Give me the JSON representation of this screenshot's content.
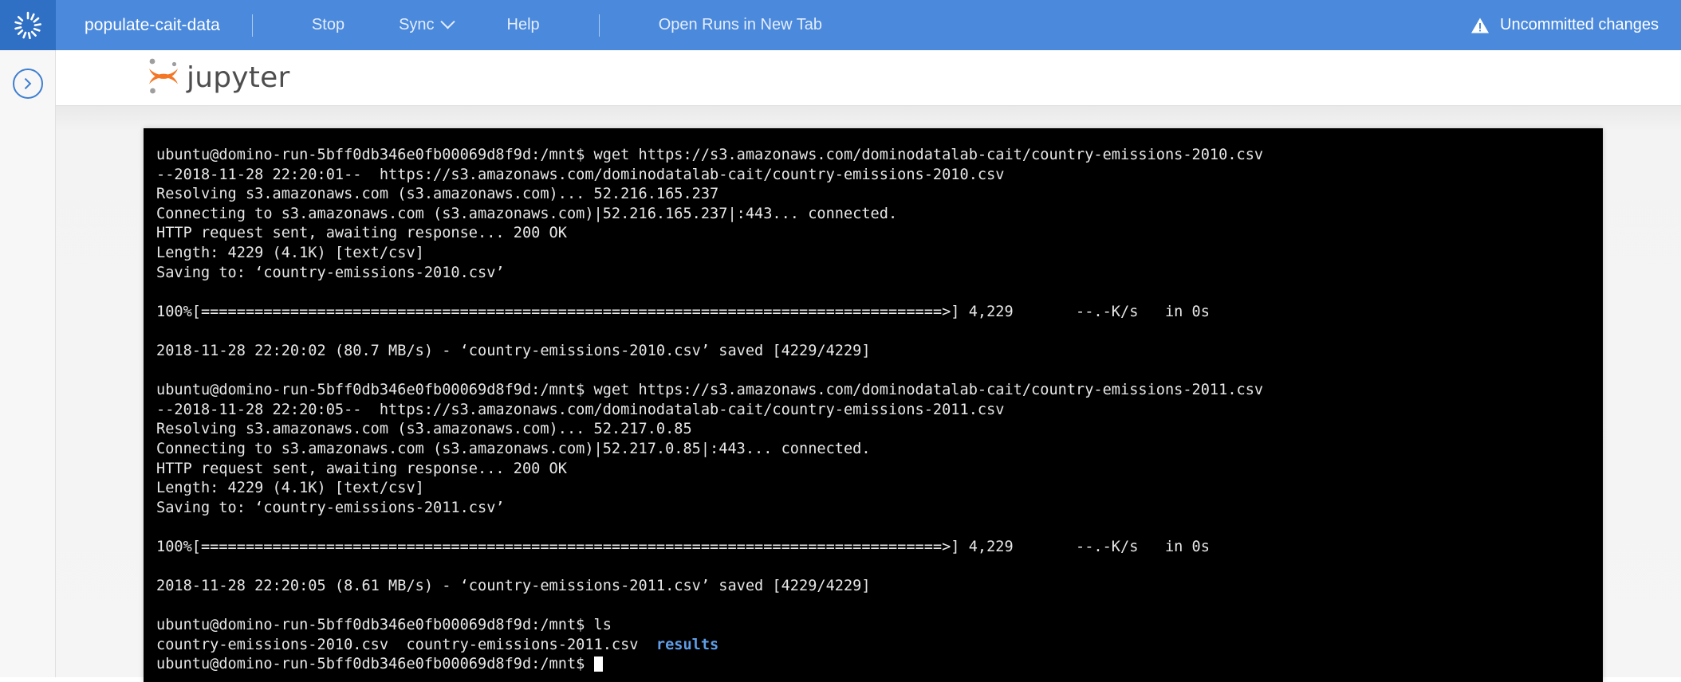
{
  "topbar": {
    "logo_icon": "domino-sunburst-icon",
    "project_title": "populate-cait-data",
    "items": [
      {
        "label": "Stop",
        "icon": null
      },
      {
        "label": "Sync",
        "icon": "chevron-down-icon"
      },
      {
        "label": "Help",
        "icon": null
      },
      {
        "label": "Open Runs in New Tab",
        "icon": null
      }
    ],
    "status": {
      "icon": "warning-triangle-icon",
      "label": "Uncommitted changes"
    },
    "colors": {
      "bar": "#4a89dc",
      "logo_tile": "#2f6fc4",
      "text": "#ffffff"
    }
  },
  "left_rail": {
    "toggle_icon": "chevron-right-circle-icon"
  },
  "jupyter_header": {
    "logo_icon": "jupyter-logo-icon",
    "wordmark": "jupyter",
    "colors": {
      "orange": "#f37726",
      "gray": "#9e9e9e",
      "text": "#4e4e4e"
    }
  },
  "terminal": {
    "prompt": "ubuntu@domino-run-5bff0db346e0fb00069d8f9d:/mnt$",
    "colors": {
      "background": "#000000",
      "foreground": "#e8e8e8",
      "directory": "#5f9ee8"
    },
    "lines": [
      {
        "type": "text",
        "text": "ubuntu@domino-run-5bff0db346e0fb00069d8f9d:/mnt$ wget https://s3.amazonaws.com/dominodatalab-cait/country-emissions-2010.csv"
      },
      {
        "type": "text",
        "text": "--2018-11-28 22:20:01--  https://s3.amazonaws.com/dominodatalab-cait/country-emissions-2010.csv"
      },
      {
        "type": "text",
        "text": "Resolving s3.amazonaws.com (s3.amazonaws.com)... 52.216.165.237"
      },
      {
        "type": "text",
        "text": "Connecting to s3.amazonaws.com (s3.amazonaws.com)|52.216.165.237|:443... connected."
      },
      {
        "type": "text",
        "text": "HTTP request sent, awaiting response... 200 OK"
      },
      {
        "type": "text",
        "text": "Length: 4229 (4.1K) [text/csv]"
      },
      {
        "type": "text",
        "text": "Saving to: ‘country-emissions-2010.csv’"
      },
      {
        "type": "blank",
        "text": ""
      },
      {
        "type": "text",
        "text": "100%[===================================================================================>] 4,229       --.-K/s   in 0s"
      },
      {
        "type": "blank",
        "text": ""
      },
      {
        "type": "text",
        "text": "2018-11-28 22:20:02 (80.7 MB/s) - ‘country-emissions-2010.csv’ saved [4229/4229]"
      },
      {
        "type": "blank",
        "text": ""
      },
      {
        "type": "text",
        "text": "ubuntu@domino-run-5bff0db346e0fb00069d8f9d:/mnt$ wget https://s3.amazonaws.com/dominodatalab-cait/country-emissions-2011.csv"
      },
      {
        "type": "text",
        "text": "--2018-11-28 22:20:05--  https://s3.amazonaws.com/dominodatalab-cait/country-emissions-2011.csv"
      },
      {
        "type": "text",
        "text": "Resolving s3.amazonaws.com (s3.amazonaws.com)... 52.217.0.85"
      },
      {
        "type": "text",
        "text": "Connecting to s3.amazonaws.com (s3.amazonaws.com)|52.217.0.85|:443... connected."
      },
      {
        "type": "text",
        "text": "HTTP request sent, awaiting response... 200 OK"
      },
      {
        "type": "text",
        "text": "Length: 4229 (4.1K) [text/csv]"
      },
      {
        "type": "text",
        "text": "Saving to: ‘country-emissions-2011.csv’"
      },
      {
        "type": "blank",
        "text": ""
      },
      {
        "type": "text",
        "text": "100%[===================================================================================>] 4,229       --.-K/s   in 0s"
      },
      {
        "type": "blank",
        "text": ""
      },
      {
        "type": "text",
        "text": "2018-11-28 22:20:05 (8.61 MB/s) - ‘country-emissions-2011.csv’ saved [4229/4229]"
      },
      {
        "type": "blank",
        "text": ""
      },
      {
        "type": "text",
        "text": "ubuntu@domino-run-5bff0db346e0fb00069d8f9d:/mnt$ ls"
      }
    ],
    "ls_output": {
      "files": "country-emissions-2010.csv  country-emissions-2011.csv  ",
      "directory": "results"
    },
    "final_prompt": "ubuntu@domino-run-5bff0db346e0fb00069d8f9d:/mnt$ "
  }
}
